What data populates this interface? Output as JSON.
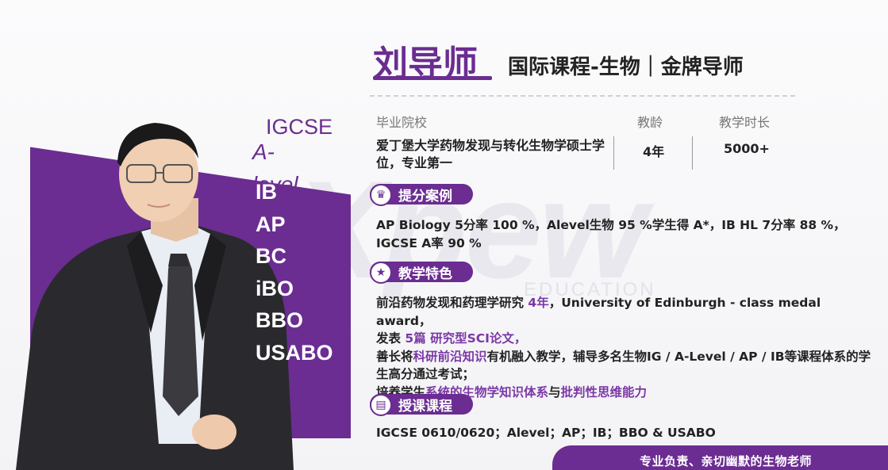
{
  "watermark": {
    "main": "Xpew",
    "sub": "EDUCATION"
  },
  "teacher": {
    "name": "刘导师",
    "title": "国际课程-生物｜金牌导师"
  },
  "courses_panel": {
    "igcse": "IGCSE",
    "alevel": "A-level",
    "items": [
      "IB",
      "AP",
      "BC",
      "iBO",
      "BBO",
      "USABO"
    ]
  },
  "info": {
    "school_label": "毕业院校",
    "years_label": "教龄",
    "hours_label": "教学时长",
    "school_value": "爱丁堡大学药物发现与转化生物学硕士学位，专业第一",
    "years_value": "4年",
    "hours_value": "5000+"
  },
  "sections": {
    "scores_title": "提分案例",
    "features_title": "教学特色",
    "courses_title": "授课课程"
  },
  "scores_text": "AP Biology 5分率 100 %，Alevel生物 95 %学生得 A*，IB HL 7分率 88 %，IGCSE A率 90 %",
  "features": {
    "line1_a": "前沿药物发现和药理学研究 ",
    "line1_hl": "4年",
    "line1_b": "，University of Edinburgh - class medal award，",
    "line2_a": "发表 ",
    "line2_hl": "5篇 研究型SCI论文，",
    "line3_a": "善长将",
    "line3_hl": "科研前沿知识",
    "line3_b": "有机融入教学，辅导多名生物IG / A-Level / AP / IB等课程体系的学生高分通过考试；",
    "line4_a": "培养学生",
    "line4_hl1": "系统的生物学知识体系",
    "line4_b": "与",
    "line4_hl2": "批判性思维能力"
  },
  "courses_text": "IGCSE 0610/0620；Alevel；AP；IB；BBO & USABO",
  "footer_slogan": "专业负责、亲切幽默的生物老师",
  "colors": {
    "brand_purple": "#6b2d91",
    "highlight": "#7b38a6"
  }
}
